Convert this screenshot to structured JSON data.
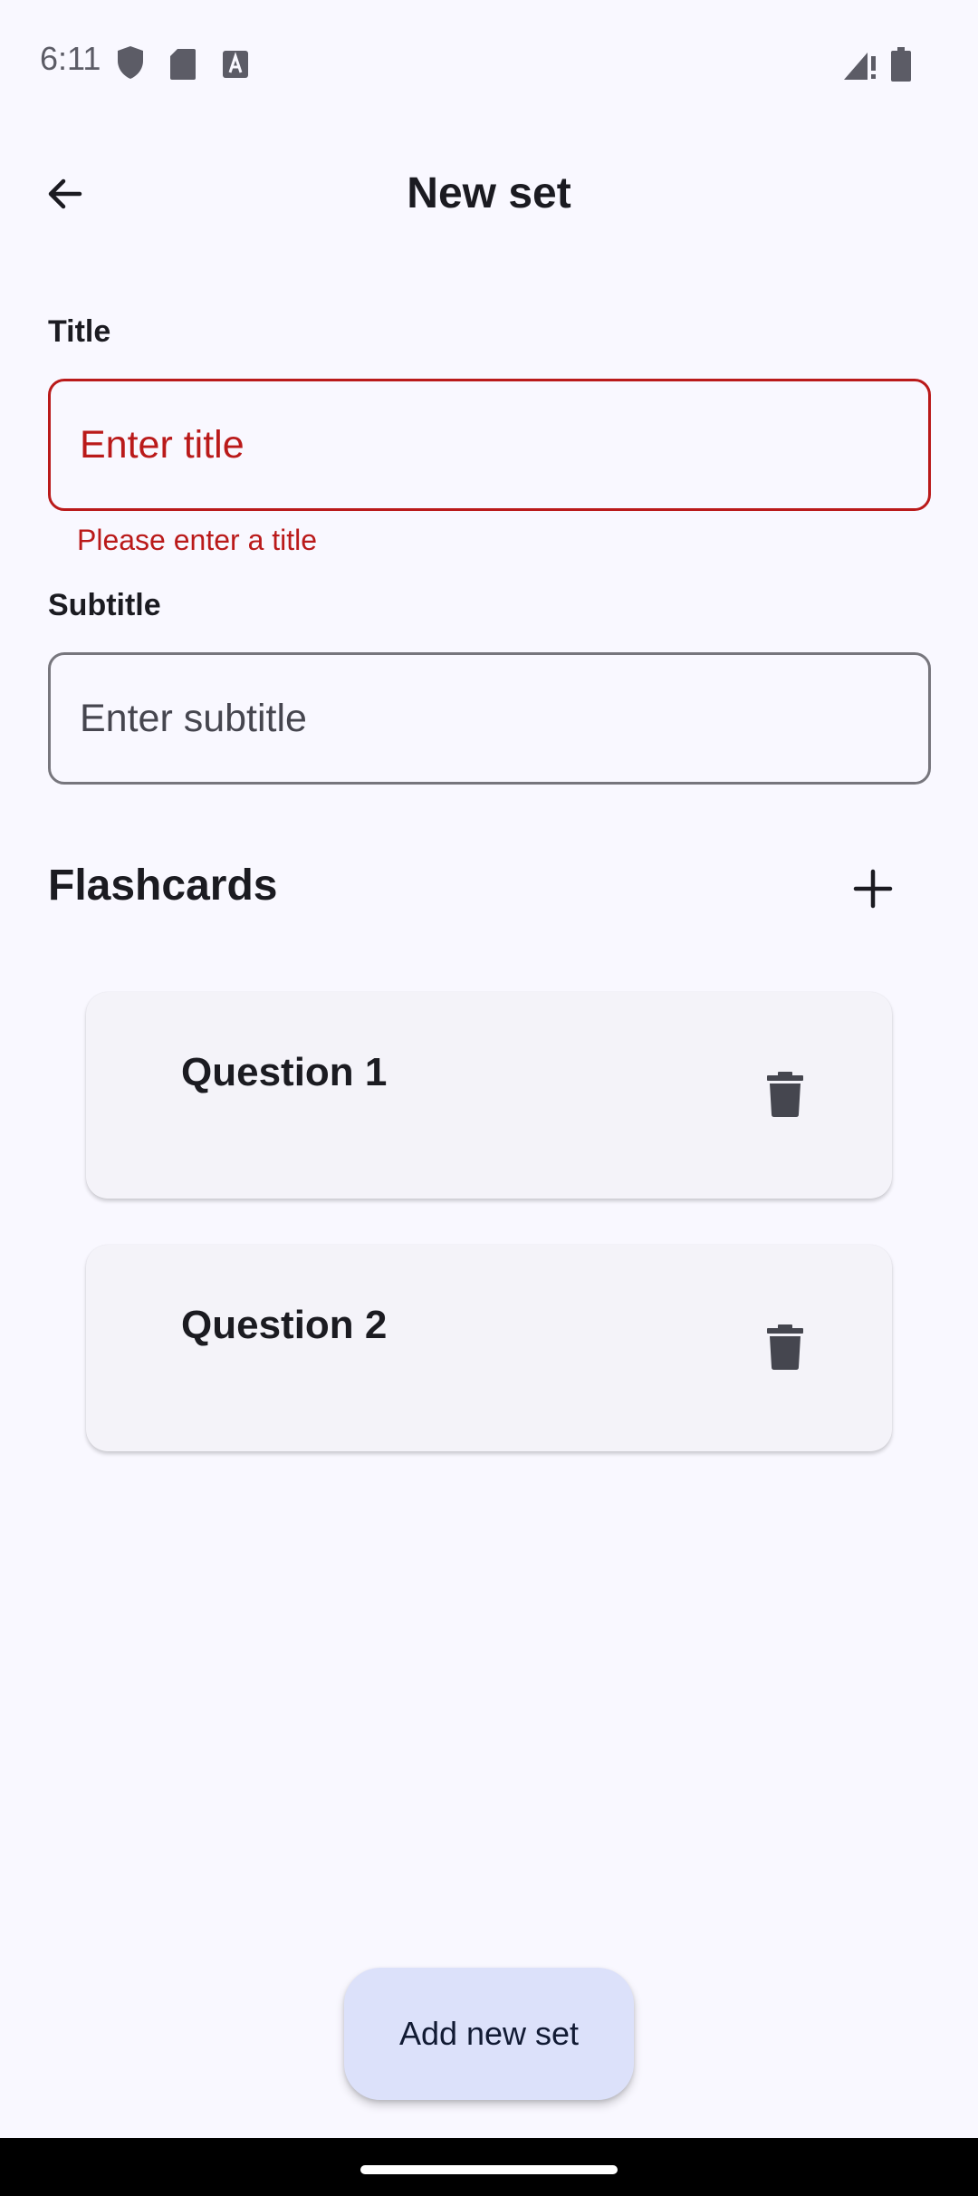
{
  "status_bar": {
    "time": "6:11",
    "icons": [
      "shield-icon",
      "sd-card-icon",
      "text-a-icon",
      "signal-icon",
      "battery-icon"
    ]
  },
  "app_bar": {
    "title": "New set",
    "back_icon": "arrow-back-icon"
  },
  "form": {
    "title_label": "Title",
    "title_placeholder": "Enter title",
    "title_error": "Please enter a title",
    "subtitle_label": "Subtitle",
    "subtitle_placeholder": "Enter subtitle"
  },
  "flashcards": {
    "section_title": "Flashcards",
    "add_icon": "plus-icon",
    "cards": [
      {
        "title": "Question 1"
      },
      {
        "title": "Question 2"
      }
    ]
  },
  "fab": {
    "label": "Add new set"
  },
  "colors": {
    "background": "#f9f8ff",
    "error": "#ba1a1a",
    "card": "#f4f3f9",
    "fab": "#dce1fa"
  }
}
